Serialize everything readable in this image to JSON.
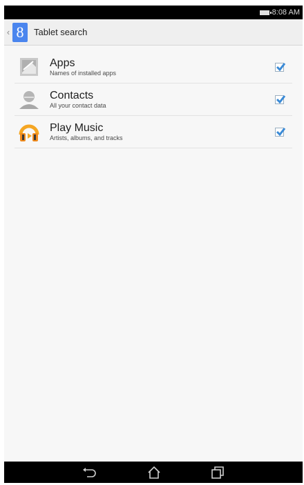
{
  "status_bar": {
    "time": "8:08 AM"
  },
  "header": {
    "title": "Tablet search",
    "logo_letter": "8"
  },
  "items": [
    {
      "title": "Apps",
      "subtitle": "Names of installed apps",
      "icon": "apps-icon",
      "checked": true
    },
    {
      "title": "Contacts",
      "subtitle": "All your contact data",
      "icon": "contacts-icon",
      "checked": true
    },
    {
      "title": "Play Music",
      "subtitle": "Artists, albums, and tracks",
      "icon": "play-music-icon",
      "checked": true
    }
  ],
  "nav": [
    "back-icon",
    "home-icon",
    "recent-apps-icon"
  ],
  "colors": {
    "accent": "#4a85ee",
    "check": "#3a8ad6",
    "music_orange": "#f5a623"
  }
}
